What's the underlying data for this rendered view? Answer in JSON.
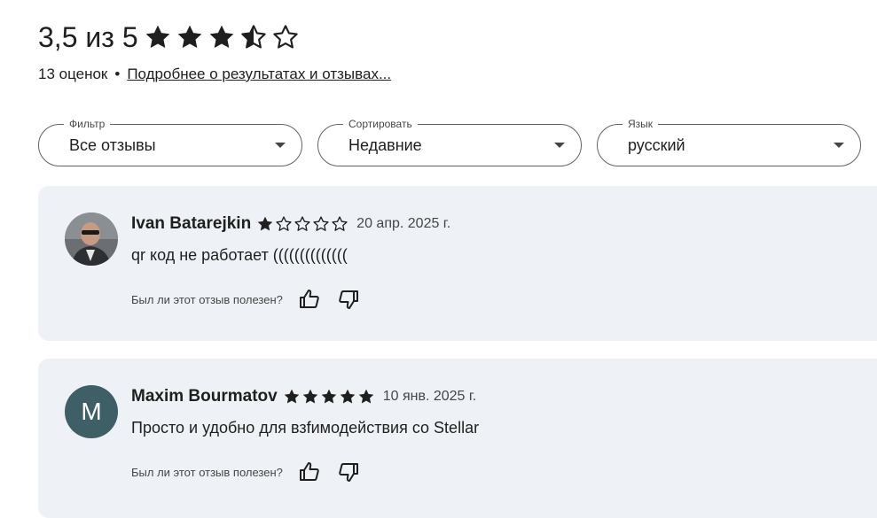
{
  "summary": {
    "rating_text": "3,5 из 5",
    "rating_value": 3.5,
    "rating_max": 5,
    "count_text": "13 оценок",
    "separator": "•",
    "details_link": "Подробнее о результатах и отзывах..."
  },
  "filters": [
    {
      "label": "Фильтр",
      "value": "Все отзывы"
    },
    {
      "label": "Сортировать",
      "value": "Недавние"
    },
    {
      "label": "Язык",
      "value": "русский"
    }
  ],
  "reviews": [
    {
      "author": "Ivan Batarejkin",
      "stars": 1,
      "date": "20 апр. 2025 г.",
      "text": "qr код не работает ((((((((((((((",
      "helpful_prompt": "Был ли этот отзыв полезен?"
    },
    {
      "author": "Maxim Bourmatov",
      "avatar_letter": "M",
      "stars": 5,
      "date": "10 янв. 2025 г.",
      "text": "Просто и удобно для взfимодействия со Stellar",
      "helpful_prompt": "Был ли этот отзыв полезен?"
    }
  ],
  "icons": {
    "star_full": "star-icon",
    "star_half": "half-star-icon",
    "star_empty": "empty-star-icon",
    "thumb_up": "thumb-up-icon",
    "thumb_down": "thumb-down-icon"
  }
}
